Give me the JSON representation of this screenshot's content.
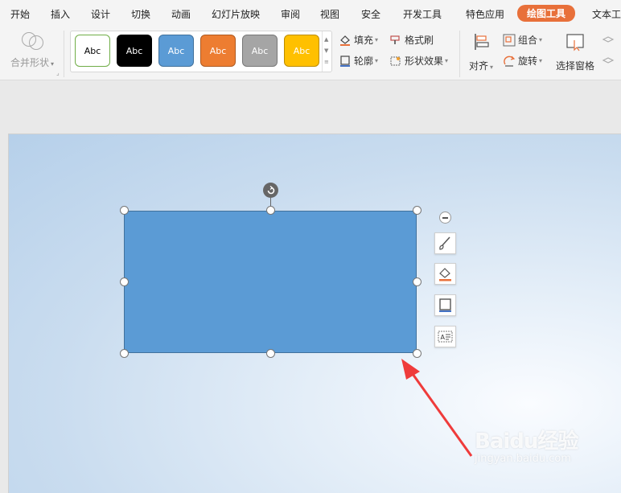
{
  "menu": {
    "tabs": [
      "开始",
      "插入",
      "设计",
      "切换",
      "动画",
      "幻灯片放映",
      "审阅",
      "视图",
      "安全",
      "开发工具",
      "特色应用",
      "绘图工具",
      "文本工"
    ],
    "active": "绘图工具",
    "accent": "#e8703a"
  },
  "ribbon": {
    "merge_shapes": "合并形状",
    "styles": [
      {
        "label": "Abc",
        "bg": "#ffffff",
        "fg": "#000000",
        "border": "#70ad47"
      },
      {
        "label": "Abc",
        "bg": "#000000",
        "fg": "#ffffff",
        "border": "#000000"
      },
      {
        "label": "Abc",
        "bg": "#5b9bd5",
        "fg": "#ffffff",
        "border": "#41719c"
      },
      {
        "label": "Abc",
        "bg": "#ed7d31",
        "fg": "#ffffff",
        "border": "#ae5a21"
      },
      {
        "label": "Abc",
        "bg": "#a5a5a5",
        "fg": "#ffffff",
        "border": "#787878"
      },
      {
        "label": "Abc",
        "bg": "#ffc000",
        "fg": "#ffffff",
        "border": "#bc8c00"
      }
    ],
    "fill": "填充",
    "outline": "轮廓",
    "format_painter": "格式刷",
    "shape_effects": "形状效果",
    "align": "对齐",
    "group": "组合",
    "rotate": "旋转",
    "selection_pane": "选择窗格"
  },
  "canvas": {
    "shape_fill": "#5b9bd5",
    "shape_border": "#41719c",
    "side_tools": [
      "brush-icon",
      "fill-icon",
      "outline-icon",
      "text-box-icon"
    ]
  },
  "watermark": {
    "main": "Baidu经验",
    "sub": "jingyan.baidu.com"
  }
}
